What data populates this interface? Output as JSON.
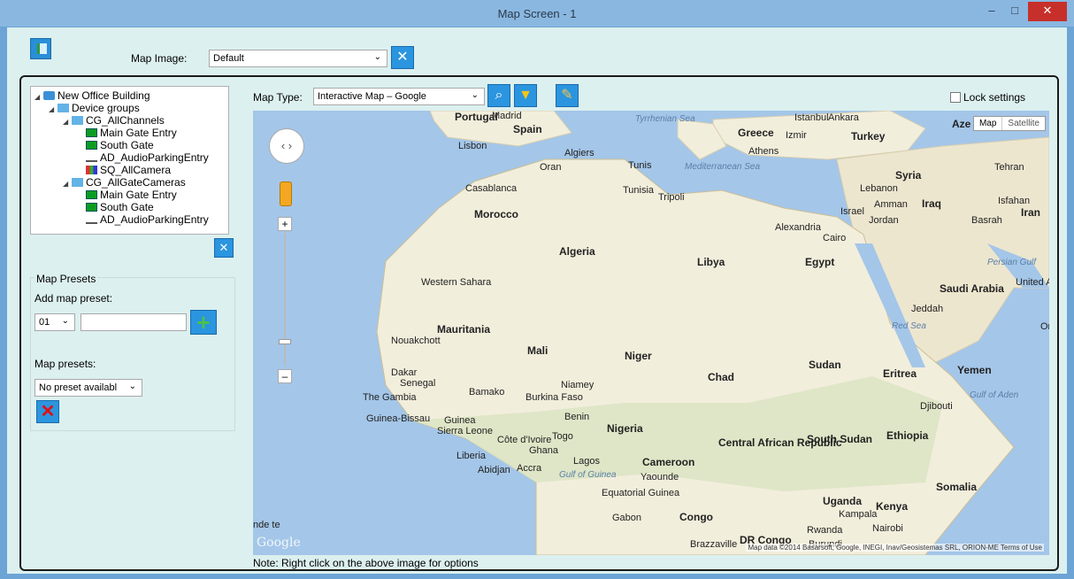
{
  "window": {
    "title": "Map Screen - 1",
    "minimize": "–",
    "maximize": "□",
    "close": "✕"
  },
  "toolbar": {
    "map_image_label": "Map Image:",
    "map_image_value": "Default"
  },
  "tree": {
    "nodes": [
      {
        "label": "New Office Building",
        "depth": 0,
        "icon": "network-icon",
        "expanded": true
      },
      {
        "label": "Device groups",
        "depth": 1,
        "icon": "folder-icon",
        "expanded": true
      },
      {
        "label": "CG_AllChannels",
        "depth": 2,
        "icon": "folder-icon",
        "expanded": true
      },
      {
        "label": "Main Gate Entry",
        "depth": 3,
        "icon": "camera-icon"
      },
      {
        "label": "South Gate",
        "depth": 3,
        "icon": "camera-icon"
      },
      {
        "label": "AD_AudioParkingEntry",
        "depth": 3,
        "icon": "audio-icon"
      },
      {
        "label": "SQ_AllCamera",
        "depth": 3,
        "icon": "sequence-icon"
      },
      {
        "label": "CG_AllGateCameras",
        "depth": 2,
        "icon": "folder-icon",
        "expanded": true
      },
      {
        "label": "Main Gate Entry",
        "depth": 3,
        "icon": "camera-icon"
      },
      {
        "label": "South Gate",
        "depth": 3,
        "icon": "camera-icon"
      },
      {
        "label": "AD_AudioParkingEntry",
        "depth": 3,
        "icon": "audio-icon"
      }
    ]
  },
  "presets": {
    "legend": "Map Presets",
    "add_label": "Add map preset:",
    "number_value": "01",
    "list_label": "Map presets:",
    "list_value": "No preset availabl"
  },
  "map_settings": {
    "type_label": "Map Type:",
    "type_value": "Interactive Map – Google",
    "lock_label": "Lock settings",
    "lock_checked": false
  },
  "map": {
    "toggle_map": "Map",
    "toggle_satellite": "Satellite",
    "google_logo": "Google",
    "attribution": "Map data ©2014 Basarsoft, Google, INEGI, Inav/Geosistemas SRL, ORION-ME   Terms of Use",
    "labels": {
      "portugal": "Portugal",
      "madrid": "Madrid",
      "spain": "Spain",
      "lisbon": "Lisbon",
      "tyrrhenian_sea": "Tyrrhenian Sea",
      "istanbul": "Istanbul",
      "ankara": "Ankara",
      "azerbaijan": "Aze",
      "greece": "Greece",
      "izmir": "Izmir",
      "turkey": "Turkey",
      "athens": "Athens",
      "algiers": "Algiers",
      "oran": "Oran",
      "tunis": "Tunis",
      "mediterranean_sea": "Mediterranean Sea",
      "syria": "Syria",
      "tehran": "Tehran",
      "casablanca": "Casablanca",
      "tunisia": "Tunisia",
      "tripoli": "Tripoli",
      "lebanon": "Lebanon",
      "amman": "Amman",
      "israel": "Israel",
      "jordan": "Jordan",
      "iraq": "Iraq",
      "isfahan": "Isfahan",
      "iran": "Iran",
      "morocco": "Morocco",
      "alexandria": "Alexandria",
      "cairo": "Cairo",
      "basrah": "Basrah",
      "algeria": "Algeria",
      "libya": "Libya",
      "egypt": "Egypt",
      "persian_gulf": "Persian Gulf",
      "western_sahara": "Western Sahara",
      "saudi_arabia": "Saudi Arabia",
      "uae": "United Ar Emirate",
      "jeddah": "Jeddah",
      "red_sea": "Red Sea",
      "mauritania": "Mauritania",
      "oman": "Or",
      "nouakchott": "Nouakchott",
      "mali": "Mali",
      "niger": "Niger",
      "sudan": "Sudan",
      "eritrea": "Eritrea",
      "yemen": "Yemen",
      "dakar": "Dakar",
      "senegal": "Senegal",
      "niamey": "Niamey",
      "chad": "Chad",
      "gulf_of_aden": "Gulf of Aden",
      "the_gambia": "The Gambia",
      "bamako": "Bamako",
      "burkina_faso": "Burkina Faso",
      "djibouti": "Djibouti",
      "guinea_bissau": "Guinea-Bissau",
      "guinea": "Guinea",
      "benin": "Benin",
      "nigeria": "Nigeria",
      "ethiopia": "Ethiopia",
      "sierra_leone": "Sierra Leone",
      "cote_divoire": "Côte d'Ivoire",
      "togo": "Togo",
      "car": "Central African Republic",
      "south_sudan": "South Sudan",
      "liberia": "Liberia",
      "ghana": "Ghana",
      "lagos": "Lagos",
      "abidjan": "Abidjan",
      "accra": "Accra",
      "gulf_of_guinea": "Gulf of Guinea",
      "cameroon": "Cameroon",
      "yaounde": "Yaounde",
      "somalia": "Somalia",
      "eq_guinea": "Equatorial Guinea",
      "uganda": "Uganda",
      "kampala": "Kampala",
      "kenya": "Kenya",
      "gabon": "Gabon",
      "congo": "Congo",
      "rwanda": "Rwanda",
      "nairobi": "Nairobi",
      "dr_congo": "DR Congo",
      "brazzaville": "Brazzaville",
      "burundi": "Burundi",
      "left_edge": "nde te"
    }
  },
  "footer": {
    "note": "Note: Right click on the above image for options"
  },
  "colors": {
    "window_bg": "#dcf0ef",
    "title_bar": "#8ab7e0",
    "accent_button": "#2b95e0",
    "map_water": "#a4c6e8",
    "map_land": "#f2eedc",
    "map_desert": "#ede6cf"
  }
}
